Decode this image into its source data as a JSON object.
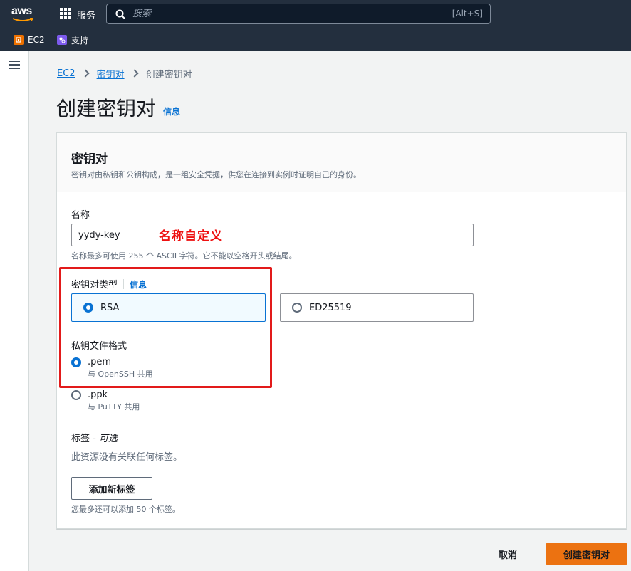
{
  "topnav": {
    "logo_text": "aws",
    "services_label": "服务",
    "search_placeholder": "搜索",
    "search_shortcut": "[Alt+S]"
  },
  "favorites": [
    {
      "label": "EC2",
      "icon": "ec2-icon"
    },
    {
      "label": "支持",
      "icon": "support-icon"
    }
  ],
  "breadcrumb": {
    "items": [
      "EC2",
      "密钥对"
    ],
    "current": "创建密钥对"
  },
  "page": {
    "title": "创建密钥对",
    "info_link": "信息"
  },
  "panel": {
    "title": "密钥对",
    "description": "密钥对由私钥和公钥构成，是一组安全凭据，供您在连接到实例时证明自己的身份。",
    "name_label": "名称",
    "name_value": "yydy-key",
    "name_hint": "名称最多可使用 255 个 ASCII 字符。它不能以空格开头或结尾。",
    "annotation": "名称自定义",
    "key_type_label": "密钥对类型",
    "key_type_info": "信息",
    "key_types": [
      {
        "label": "RSA",
        "selected": true
      },
      {
        "label": "ED25519",
        "selected": false
      }
    ],
    "format_label": "私钥文件格式",
    "formats": [
      {
        "label": ".pem",
        "desc": "与 OpenSSH 共用",
        "selected": true
      },
      {
        "label": ".ppk",
        "desc": "与 PuTTY 共用",
        "selected": false
      }
    ],
    "tags_label": "标签",
    "tags_optional": "可选",
    "tags_empty": "此资源没有关联任何标签。",
    "add_tag_button": "添加新标签",
    "tags_hint": "您最多还可以添加 50 个标签。"
  },
  "footer": {
    "cancel_label": "取消",
    "create_label": "创建密钥对"
  },
  "colors": {
    "nav_bg": "#232f3e",
    "link": "#0972d3",
    "primary_button": "#ec7211",
    "annotation_red": "#e21a1a"
  }
}
